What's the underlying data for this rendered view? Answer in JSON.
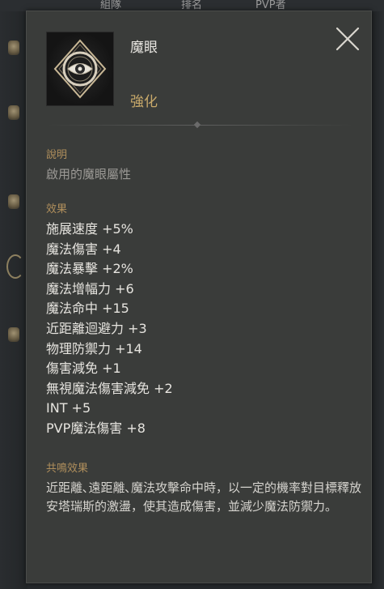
{
  "background": {
    "tabs": [
      "組隊",
      "排名",
      "PVP者"
    ]
  },
  "tooltip": {
    "item_name": "魔眼",
    "item_type": "強化",
    "icon": "eye-emblem-icon",
    "close_icon": "close-icon",
    "description": {
      "heading": "說明",
      "text": "啟用的魔眼屬性"
    },
    "effects": {
      "heading": "效果",
      "items": [
        "施展速度 +5%",
        "魔法傷害 +4",
        "魔法暴擊 +2%",
        "魔法增幅力 +6",
        "魔法命中 +15",
        "近距離迴避力 +3",
        "物理防禦力 +14",
        "傷害減免 +1",
        "無視魔法傷害減免 +2",
        "INT +5",
        "PVP魔法傷害 +8"
      ]
    },
    "resonance": {
      "heading": "共鳴效果",
      "text": "近距離､遠距離､魔法攻擊命中時，以一定的機率對目標釋放安塔瑞斯的激盪，使其造成傷害，並減少魔法防禦力。"
    }
  },
  "colors": {
    "panel_bg": "#3a3c3a",
    "section_heading": "#b08f5c",
    "item_type": "#c8a96a",
    "text_primary": "#e6e4df",
    "text_muted": "#9c9a96"
  }
}
